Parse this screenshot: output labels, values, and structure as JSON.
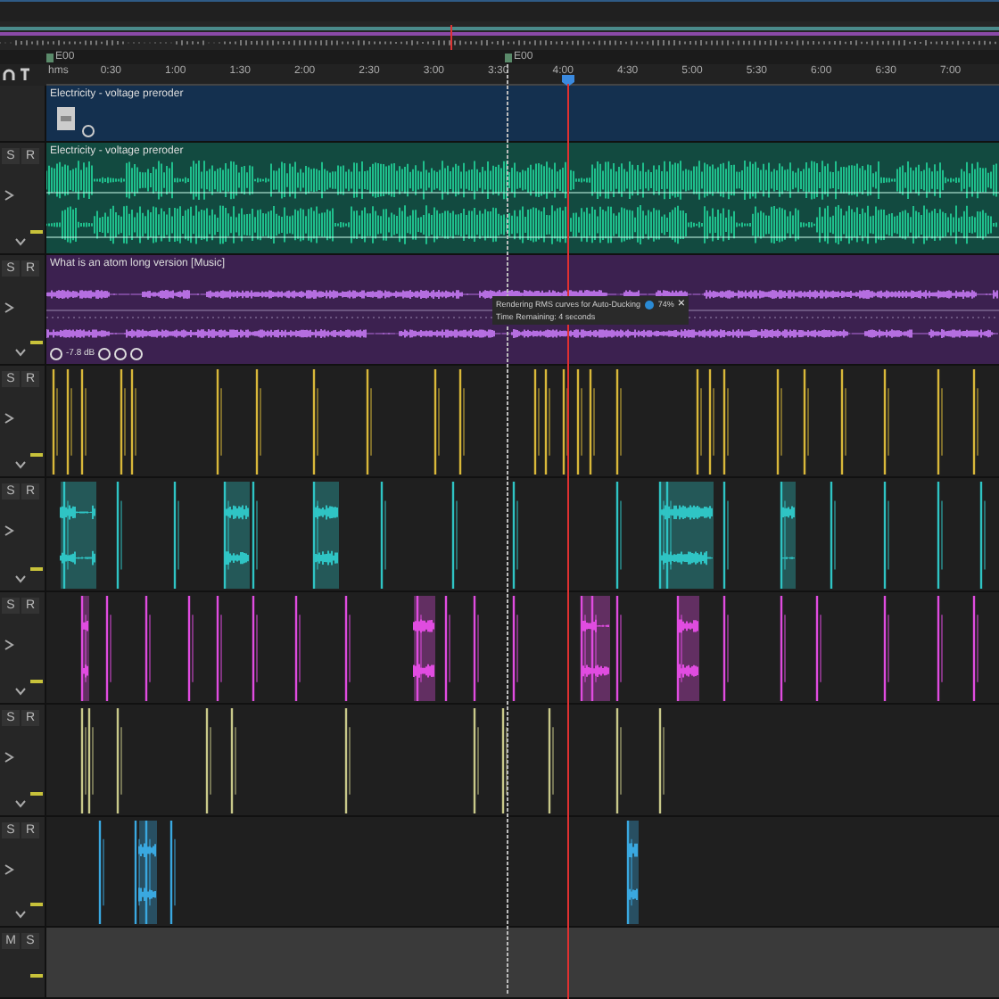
{
  "markers": [
    {
      "label": "E00"
    },
    {
      "label": "E00"
    }
  ],
  "ruler": {
    "unit": "hms",
    "labels": [
      "0:30",
      "1:00",
      "1:30",
      "2:00",
      "2:30",
      "3:00",
      "3:30",
      "4:00",
      "4:30",
      "5:00",
      "5:30",
      "6:00",
      "6:30",
      "7:00"
    ]
  },
  "tracks": [
    {
      "kind": "video",
      "title": "Electricity - voltage preroder"
    },
    {
      "kind": "audio",
      "title": "Electricity - voltage preroder",
      "color": "#1fbf8c",
      "buttons": [
        "S",
        "R"
      ]
    },
    {
      "kind": "music",
      "title": "What is an atom long version [Music]",
      "color": "#b56ee0",
      "gain": "-7.8 dB",
      "buttons": [
        "S",
        "R"
      ]
    },
    {
      "kind": "clips",
      "color": "#d9b83a",
      "buttons": [
        "S",
        "R"
      ]
    },
    {
      "kind": "clips",
      "color": "#2fc4c4",
      "buttons": [
        "S",
        "R"
      ]
    },
    {
      "kind": "clips",
      "color": "#e04ce0",
      "buttons": [
        "S",
        "R"
      ]
    },
    {
      "kind": "clips",
      "color": "#c9c98a",
      "buttons": [
        "S",
        "R"
      ]
    },
    {
      "kind": "clips",
      "color": "#3aa8e0",
      "buttons": [
        "S",
        "R"
      ]
    },
    {
      "kind": "empty",
      "buttons": [
        "M",
        "S"
      ]
    }
  ],
  "notification": {
    "message": "Rendering RMS curves for Auto-Ducking",
    "percent": "74%",
    "close": "×",
    "remaining": "Time Remaining: 4 seconds"
  }
}
